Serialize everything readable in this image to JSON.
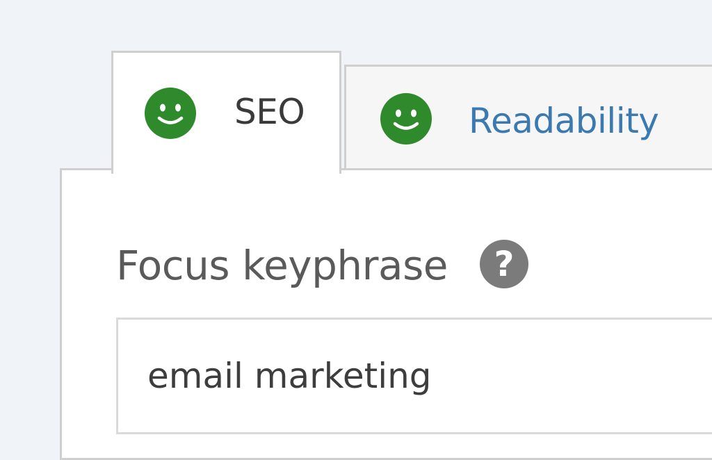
{
  "tabs": [
    {
      "label": "SEO",
      "status": "good",
      "status_icon": "smiley-face-icon",
      "active": true
    },
    {
      "label": "Readability",
      "status": "good",
      "status_icon": "smiley-face-icon",
      "active": false
    }
  ],
  "focus_keyphrase": {
    "label": "Focus keyphrase",
    "help_icon": "question-mark-icon",
    "help_glyph": "?",
    "value": "email marketing"
  },
  "colors": {
    "page_background": "#f0f3f8",
    "good_status_green": "#2e8a2b",
    "link_blue": "#3a7ab0",
    "border_gray": "#cfcfcf"
  }
}
